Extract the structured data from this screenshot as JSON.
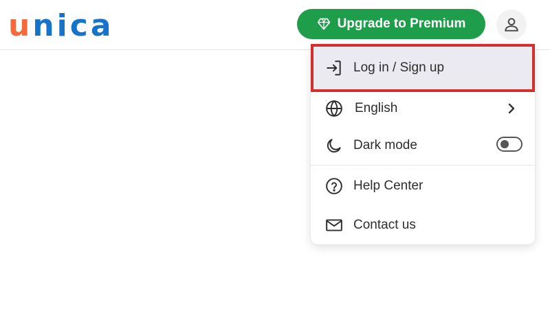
{
  "header": {
    "logo": {
      "first_letter": "u",
      "rest": "nica"
    },
    "premium_button": {
      "label": "Upgrade to Premium",
      "icon": "diamond-icon",
      "color": "#1e9e4a"
    },
    "user_button": {
      "icon": "user-icon"
    }
  },
  "menu": {
    "items": [
      {
        "label": "Log in / Sign up",
        "icon": "login-icon",
        "highlighted": true
      },
      {
        "label": "English",
        "icon": "globe-icon",
        "trailing": "chevron-right-icon"
      },
      {
        "label": "Dark mode",
        "icon": "moon-icon",
        "trailing": "toggle",
        "toggle_on": false
      },
      {
        "label": "Help Center",
        "icon": "help-circle-icon"
      },
      {
        "label": "Contact us",
        "icon": "mail-icon"
      }
    ]
  },
  "colors": {
    "logo_u": "#f26a3d",
    "logo_rest": "#1673c9",
    "highlight_border": "#d32f2f"
  }
}
